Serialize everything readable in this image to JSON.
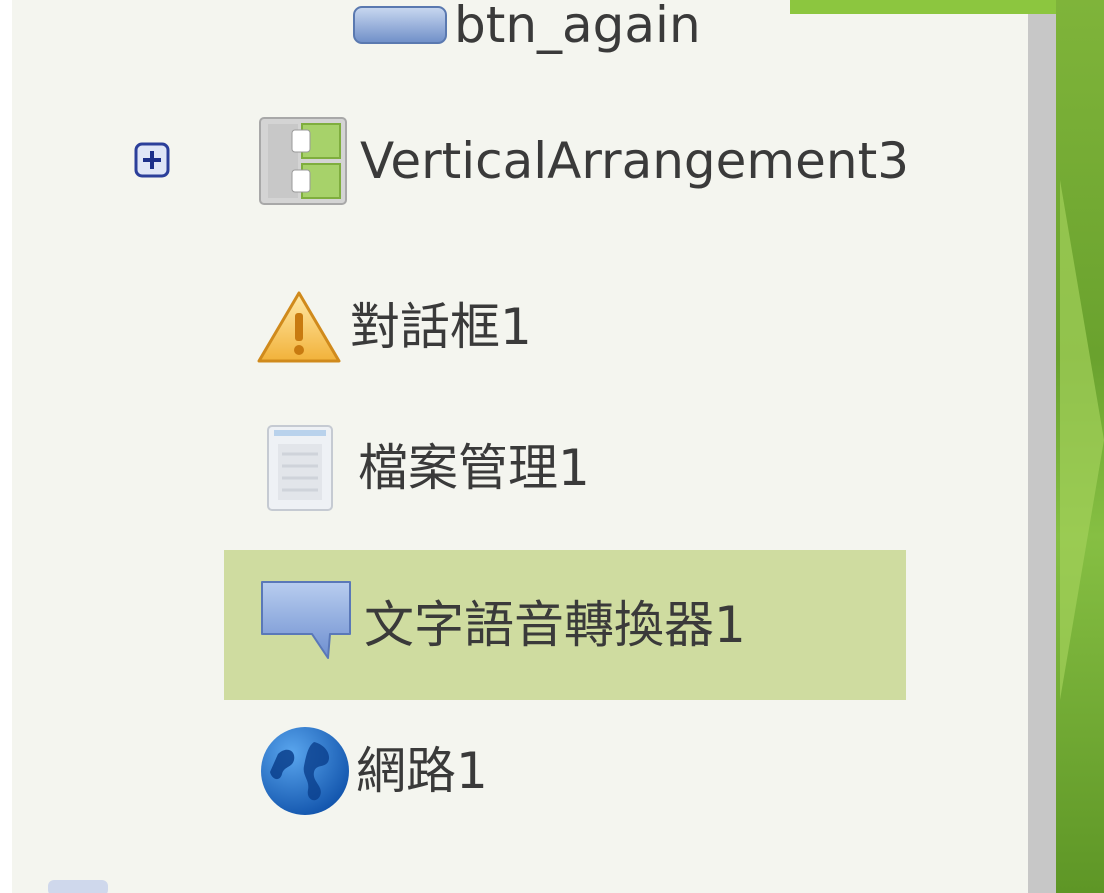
{
  "components_tree": {
    "items": [
      {
        "label": "btn_again",
        "icon": "button-icon",
        "selected": false
      },
      {
        "label": "VerticalArrangement3",
        "icon": "vertical-arrangement-icon",
        "selected": false,
        "expander": "expand-plus-icon"
      },
      {
        "label": "對話框1",
        "icon": "warning-notifier-icon",
        "selected": false
      },
      {
        "label": "檔案管理1",
        "icon": "file-document-icon",
        "selected": false
      },
      {
        "label": "文字語音轉換器1",
        "icon": "speech-bubble-icon",
        "selected": true
      },
      {
        "label": "網路1",
        "icon": "globe-web-icon",
        "selected": false
      }
    ]
  },
  "colors": {
    "panel_background": "#f4f5ef",
    "selected_row": "#cfdca0",
    "text": "#3a3a3a",
    "scrollbar": "#c7c7c7",
    "slide_accent": "#7fb43a"
  }
}
